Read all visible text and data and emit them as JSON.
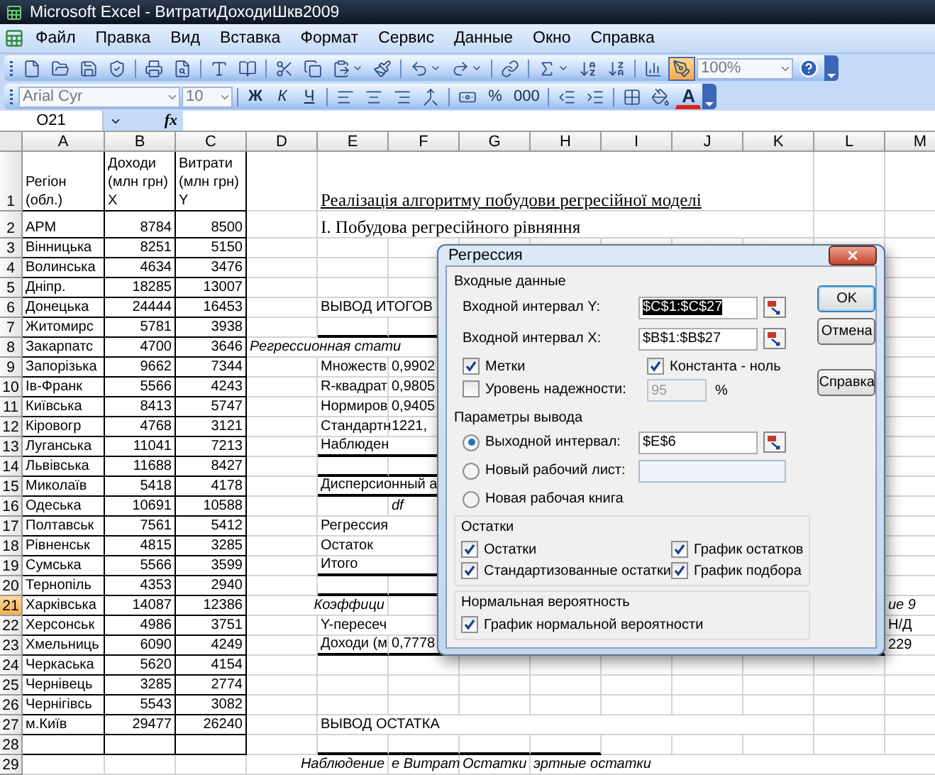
{
  "window": {
    "title": "Microsoft Excel - ВитратиДоходиШкв2009"
  },
  "menu": [
    "Файл",
    "Правка",
    "Вид",
    "Вставка",
    "Формат",
    "Сервис",
    "Данные",
    "Окно",
    "Справка"
  ],
  "standard_toolbar": {
    "buttons": [
      {
        "pressed": false
      },
      {
        "pressed": false
      },
      {
        "pressed": false
      },
      {
        "pressed": false
      },
      {
        "pressed": false
      },
      {
        "pressed": false
      },
      {
        "pressed": false
      },
      {
        "pressed": false
      },
      {
        "pressed": false
      },
      {
        "pressed": false
      },
      {
        "pressed": false
      },
      {
        "pressed": false
      },
      {
        "pressed": false
      },
      {
        "pressed": false
      },
      {
        "pressed": false
      },
      {
        "pressed": false
      },
      {
        "pressed": false
      },
      {
        "pressed": false
      },
      {
        "pressed": false
      },
      {
        "pressed": true
      }
    ],
    "zoom": "100%"
  },
  "formatting_toolbar": {
    "font": "Arial Cyr",
    "size": "10",
    "style_buttons": [
      "Ж",
      "К",
      "Ч"
    ],
    "number_buttons": [
      "%",
      "000"
    ],
    "font_color": "A"
  },
  "formula_bar": {
    "name_box": "O21",
    "function_label": "fx"
  },
  "sheet": {
    "columns": [
      "A",
      "B",
      "C",
      "D",
      "E",
      "F",
      "G",
      "H",
      "I",
      "J",
      "K",
      "L",
      "M"
    ],
    "rows": [
      {
        "number": "1",
        "selected": false,
        "boxed": true,
        "rule_below": false,
        "cells": [
          {
            "kind": "wrap",
            "text": "Регіон\n(обл.)"
          },
          {
            "kind": "wrap",
            "text": "Доходи\n(млн грн)\nX"
          },
          {
            "kind": "wrap",
            "text": "Витрати\n(млн грн)\nY"
          },
          "",
          {
            "kind": "title",
            "text": "Реалізація алгоритму побудови регресійної моделі"
          }
        ]
      },
      {
        "number": "2",
        "selected": false,
        "boxed": true,
        "rule_below": false,
        "cells": [
          {
            "kind": "text",
            "text": "АРМ"
          },
          {
            "kind": "number",
            "text": "8784"
          },
          {
            "kind": "number",
            "text": "8500"
          },
          "",
          {
            "kind": "serif",
            "text": "І. Побудова регресійного рівняння"
          }
        ]
      },
      {
        "number": "3",
        "selected": false,
        "boxed": true,
        "rule_below": false,
        "cells": [
          {
            "kind": "text",
            "text": "Вінницька"
          },
          {
            "kind": "number",
            "text": "8251"
          },
          {
            "kind": "number",
            "text": "5150"
          }
        ]
      },
      {
        "number": "4",
        "selected": false,
        "boxed": true,
        "rule_below": false,
        "cells": [
          {
            "kind": "text",
            "text": "Волинська"
          },
          {
            "kind": "number",
            "text": "4634"
          },
          {
            "kind": "number",
            "text": "3476"
          }
        ]
      },
      {
        "number": "5",
        "selected": false,
        "boxed": true,
        "rule_below": false,
        "cells": [
          {
            "kind": "text",
            "text": "Дніпр."
          },
          {
            "kind": "number",
            "text": "18285"
          },
          {
            "kind": "number",
            "text": "13007"
          }
        ]
      },
      {
        "number": "6",
        "selected": false,
        "boxed": true,
        "rule_below": false,
        "cells": [
          {
            "kind": "text",
            "text": "Донецька"
          },
          {
            "kind": "number",
            "text": "24444"
          },
          {
            "kind": "number",
            "text": "16453"
          },
          "",
          {
            "kind": "text",
            "text": "ВЫВОД ИТОГОВ"
          }
        ]
      },
      {
        "number": "7",
        "selected": false,
        "boxed": true,
        "rule_below": true,
        "cells": [
          {
            "kind": "text",
            "text": "Житомирс"
          },
          {
            "kind": "number",
            "text": "5781"
          },
          {
            "kind": "number",
            "text": "3938"
          }
        ]
      },
      {
        "number": "8",
        "selected": false,
        "boxed": true,
        "rule_below": false,
        "cells": [
          {
            "kind": "text",
            "text": "Закарпатс"
          },
          {
            "kind": "number",
            "text": "4700"
          },
          {
            "kind": "number",
            "text": "3646"
          },
          {
            "kind": "italic",
            "text": "Регрессионная стати"
          }
        ]
      },
      {
        "number": "9",
        "selected": false,
        "boxed": true,
        "rule_below": false,
        "cells": [
          {
            "kind": "text",
            "text": "Запорізька"
          },
          {
            "kind": "number",
            "text": "9662"
          },
          {
            "kind": "number",
            "text": "7344"
          },
          "",
          {
            "kind": "text",
            "text": "Множеств"
          },
          {
            "kind": "text",
            "text": "0,9902"
          }
        ]
      },
      {
        "number": "10",
        "selected": false,
        "boxed": true,
        "rule_below": false,
        "cells": [
          {
            "kind": "text",
            "text": "Ів-Франк"
          },
          {
            "kind": "number",
            "text": "5566"
          },
          {
            "kind": "number",
            "text": "4243"
          },
          "",
          {
            "kind": "text",
            "text": "R-квадрат"
          },
          {
            "kind": "text",
            "text": "0,9805"
          }
        ]
      },
      {
        "number": "11",
        "selected": false,
        "boxed": true,
        "rule_below": false,
        "cells": [
          {
            "kind": "text",
            "text": "Київська"
          },
          {
            "kind": "number",
            "text": "8413"
          },
          {
            "kind": "number",
            "text": "5747"
          },
          "",
          {
            "kind": "text",
            "text": "Нормиров"
          },
          {
            "kind": "text",
            "text": "0,9405"
          }
        ]
      },
      {
        "number": "12",
        "selected": false,
        "boxed": true,
        "rule_below": false,
        "cells": [
          {
            "kind": "text",
            "text": "Кіровогр"
          },
          {
            "kind": "number",
            "text": "4768"
          },
          {
            "kind": "number",
            "text": "3121"
          },
          "",
          {
            "kind": "text",
            "text": "Стандартн"
          },
          {
            "kind": "text",
            "text": "1221,"
          }
        ]
      },
      {
        "number": "13",
        "selected": false,
        "boxed": true,
        "rule_below": true,
        "cells": [
          {
            "kind": "text",
            "text": "Луганська"
          },
          {
            "kind": "number",
            "text": "11041"
          },
          {
            "kind": "number",
            "text": "7213"
          },
          "",
          {
            "kind": "text",
            "text": "Наблюден"
          }
        ]
      },
      {
        "number": "14",
        "selected": false,
        "boxed": true,
        "rule_below": true,
        "cells": [
          {
            "kind": "text",
            "text": "Львівська"
          },
          {
            "kind": "number",
            "text": "11688"
          },
          {
            "kind": "number",
            "text": "8427"
          }
        ]
      },
      {
        "number": "15",
        "selected": false,
        "boxed": true,
        "rule_below": true,
        "cells": [
          {
            "kind": "text",
            "text": "Миколаїв"
          },
          {
            "kind": "number",
            "text": "5418"
          },
          {
            "kind": "number",
            "text": "4178"
          },
          "",
          {
            "kind": "text",
            "text": "Дисперсионный а"
          }
        ]
      },
      {
        "number": "16",
        "selected": false,
        "boxed": true,
        "rule_below": false,
        "cells": [
          {
            "kind": "text",
            "text": "Одеська"
          },
          {
            "kind": "number",
            "text": "10691"
          },
          {
            "kind": "number",
            "text": "10588"
          },
          "",
          "",
          {
            "kind": "italic",
            "text": "df"
          }
        ]
      },
      {
        "number": "17",
        "selected": false,
        "boxed": true,
        "rule_below": false,
        "cells": [
          {
            "kind": "text",
            "text": "Полтавськ"
          },
          {
            "kind": "number",
            "text": "7561"
          },
          {
            "kind": "number",
            "text": "5412"
          },
          "",
          {
            "kind": "text",
            "text": "Регрессия"
          }
        ]
      },
      {
        "number": "18",
        "selected": false,
        "boxed": true,
        "rule_below": false,
        "cells": [
          {
            "kind": "text",
            "text": "Рівненськ"
          },
          {
            "kind": "number",
            "text": "4815"
          },
          {
            "kind": "number",
            "text": "3285"
          },
          "",
          {
            "kind": "text",
            "text": "Остаток"
          }
        ]
      },
      {
        "number": "19",
        "selected": false,
        "boxed": true,
        "rule_below": true,
        "cells": [
          {
            "kind": "text",
            "text": "Сумська"
          },
          {
            "kind": "number",
            "text": "5566"
          },
          {
            "kind": "number",
            "text": "3599"
          },
          "",
          {
            "kind": "text",
            "text": "Итого"
          }
        ]
      },
      {
        "number": "20",
        "selected": false,
        "boxed": true,
        "rule_below": true,
        "cells": [
          {
            "kind": "text",
            "text": "Тернопіль"
          },
          {
            "kind": "number",
            "text": "4353"
          },
          {
            "kind": "number",
            "text": "2940"
          }
        ]
      },
      {
        "number": "21",
        "selected": true,
        "boxed": true,
        "rule_below": false,
        "cells": [
          {
            "kind": "text",
            "text": "Харківська"
          },
          {
            "kind": "number",
            "text": "14087"
          },
          {
            "kind": "number",
            "text": "12386"
          },
          "",
          {
            "kind": "italic-right",
            "text": "Коэффици"
          },
          "",
          "",
          "",
          "",
          "",
          "",
          "",
          {
            "kind": "italic",
            "text": "ие 9"
          }
        ]
      },
      {
        "number": "22",
        "selected": false,
        "boxed": true,
        "rule_below": false,
        "cells": [
          {
            "kind": "text",
            "text": "Херсонськ"
          },
          {
            "kind": "number",
            "text": "4986"
          },
          {
            "kind": "number",
            "text": "3751"
          },
          "",
          {
            "kind": "text",
            "text": "Y-пересеч"
          },
          "",
          "",
          "",
          "",
          "",
          "",
          "",
          {
            "kind": "text",
            "text": "Н/Д"
          }
        ]
      },
      {
        "number": "23",
        "selected": false,
        "boxed": true,
        "rule_below": true,
        "cells": [
          {
            "kind": "text",
            "text": "Хмельниць"
          },
          {
            "kind": "number",
            "text": "6090"
          },
          {
            "kind": "number",
            "text": "4249"
          },
          "",
          {
            "kind": "text",
            "text": "Доходи (м"
          },
          {
            "kind": "text",
            "text": "0,7778"
          },
          "",
          "",
          "",
          "",
          "",
          "",
          {
            "kind": "text",
            "text": "229"
          }
        ]
      },
      {
        "number": "24",
        "selected": false,
        "boxed": true,
        "rule_below": false,
        "cells": [
          {
            "kind": "text",
            "text": "Черкаська"
          },
          {
            "kind": "number",
            "text": "5620"
          },
          {
            "kind": "number",
            "text": "4154"
          }
        ]
      },
      {
        "number": "25",
        "selected": false,
        "boxed": true,
        "rule_below": false,
        "cells": [
          {
            "kind": "text",
            "text": "Чернівець"
          },
          {
            "kind": "number",
            "text": "3285"
          },
          {
            "kind": "number",
            "text": "2774"
          }
        ]
      },
      {
        "number": "26",
        "selected": false,
        "boxed": true,
        "rule_below": false,
        "cells": [
          {
            "kind": "text",
            "text": "Чернігівсь"
          },
          {
            "kind": "number",
            "text": "5543"
          },
          {
            "kind": "number",
            "text": "3082"
          }
        ]
      },
      {
        "number": "27",
        "selected": false,
        "boxed": true,
        "rule_below": false,
        "cells": [
          {
            "kind": "text",
            "text": "м.Київ"
          },
          {
            "kind": "number",
            "text": "29477"
          },
          {
            "kind": "number",
            "text": "26240"
          },
          "",
          {
            "kind": "text",
            "text": "ВЫВОД ОСТАТКА"
          }
        ]
      },
      {
        "number": "28",
        "selected": false,
        "boxed": true,
        "rule_below": true,
        "cells": []
      },
      {
        "number": "29",
        "selected": false,
        "boxed": false,
        "rule_below": false,
        "cells": [
          "",
          "",
          "",
          "",
          {
            "kind": "italic-right",
            "text": "Наблюдение"
          },
          {
            "kind": "italic",
            "text": "е Витрат"
          },
          {
            "kind": "italic",
            "text": "Остатки"
          },
          {
            "kind": "italic",
            "text": "эртные остатки"
          }
        ]
      }
    ]
  },
  "dialog": {
    "title": "Регрессия",
    "input_group": {
      "legend": "Входные данные",
      "fields": [
        {
          "label": "Входной интервал Y:",
          "value": "$C$1:$C$27",
          "selected": true
        },
        {
          "label": "Входной интервал X:",
          "value": "$B$1:$B$27",
          "selected": false
        }
      ],
      "options": [
        {
          "label": "Метки",
          "checked": true
        },
        {
          "label": "Константа - ноль",
          "checked": true
        },
        {
          "label": "Уровень надежности:",
          "checked": false
        }
      ],
      "confidence": {
        "value": "95",
        "disabled": true,
        "unit": "%"
      }
    },
    "buttons": [
      {
        "label": "OK",
        "default": true
      },
      {
        "label": "Отмена",
        "default": false
      },
      {
        "label": "Справка",
        "default": false
      }
    ],
    "output_group": {
      "legend": "Параметры вывода",
      "destinations": [
        {
          "label": "Выходной интервал:",
          "selected": true,
          "kind": "ref",
          "value": "$E$6"
        },
        {
          "label": "Новый рабочий лист:",
          "selected": false,
          "kind": "field"
        },
        {
          "label": "Новая рабочая книга",
          "selected": false,
          "kind": "plain"
        }
      ],
      "residuals": {
        "legend": "Остатки",
        "options": [
          {
            "label": "Остатки",
            "checked": true
          },
          {
            "label": "График остатков",
            "checked": true
          },
          {
            "label": "Стандартизованные остатки",
            "checked": true
          },
          {
            "label": "График подбора",
            "checked": true
          }
        ]
      },
      "normal": {
        "legend": "Нормальная вероятность",
        "options": [
          {
            "label": "График нормальной вероятности",
            "checked": true
          }
        ]
      }
    }
  }
}
